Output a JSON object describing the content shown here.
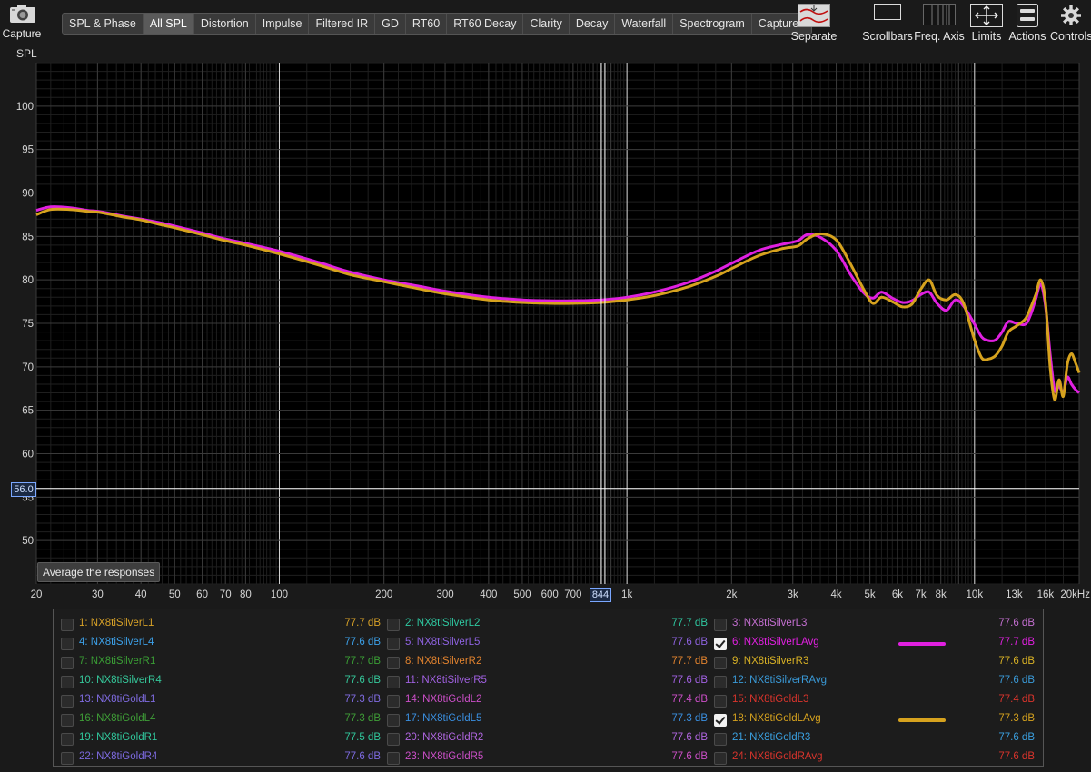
{
  "toolbar": {
    "capture_label": "Capture",
    "tabs": [
      {
        "label": "SPL & Phase",
        "active": false
      },
      {
        "label": "All SPL",
        "active": true
      },
      {
        "label": "Distortion",
        "active": false
      },
      {
        "label": "Impulse",
        "active": false
      },
      {
        "label": "Filtered IR",
        "active": false
      },
      {
        "label": "GD",
        "active": false
      },
      {
        "label": "RT60",
        "active": false
      },
      {
        "label": "RT60 Decay",
        "active": false
      },
      {
        "label": "Clarity",
        "active": false
      },
      {
        "label": "Decay",
        "active": false
      },
      {
        "label": "Waterfall",
        "active": false
      },
      {
        "label": "Spectrogram",
        "active": false
      },
      {
        "label": "Captured",
        "active": false
      }
    ],
    "tools": {
      "separate": "Separate",
      "scrollbars": "Scrollbars",
      "freq_axis": "Freq. Axis",
      "limits": "Limits",
      "actions": "Actions",
      "controls": "Controls"
    }
  },
  "graph": {
    "y_axis_title": "SPL",
    "average_button": "Average the responses",
    "cursor_y_readout": "56.0",
    "cursor_x_readout": "844",
    "colors": {
      "background": "#000000",
      "grid_major": "#3a3a3a",
      "grid_minor": "#1f1f1f",
      "cursor": "#ffffff"
    }
  },
  "chart_data": {
    "type": "line",
    "y_tick_labels": [
      "100",
      "95",
      "90",
      "85",
      "80",
      "75",
      "70",
      "65",
      "60",
      "55",
      "50"
    ],
    "y_ticks": [
      100,
      95,
      90,
      85,
      80,
      75,
      70,
      65,
      60,
      55,
      50
    ],
    "x_tick_labels": [
      {
        "f": 20,
        "t": "20"
      },
      {
        "f": 30,
        "t": "30"
      },
      {
        "f": 40,
        "t": "40"
      },
      {
        "f": 50,
        "t": "50"
      },
      {
        "f": 60,
        "t": "60"
      },
      {
        "f": 70,
        "t": "70"
      },
      {
        "f": 80,
        "t": "80"
      },
      {
        "f": 100,
        "t": "100"
      },
      {
        "f": 200,
        "t": "200"
      },
      {
        "f": 300,
        "t": "300"
      },
      {
        "f": 400,
        "t": "400"
      },
      {
        "f": 500,
        "t": "500"
      },
      {
        "f": 600,
        "t": "600"
      },
      {
        "f": 700,
        "t": "700"
      },
      {
        "f": 800,
        "t": "8"
      },
      {
        "f": 1000,
        "t": "1k"
      },
      {
        "f": 2000,
        "t": "2k"
      },
      {
        "f": 3000,
        "t": "3k"
      },
      {
        "f": 4000,
        "t": "4k"
      },
      {
        "f": 5000,
        "t": "5k"
      },
      {
        "f": 6000,
        "t": "6k"
      },
      {
        "f": 7000,
        "t": "7k"
      },
      {
        "f": 8000,
        "t": "8k"
      },
      {
        "f": 10000,
        "t": "10k"
      },
      {
        "f": 13000,
        "t": "13k"
      },
      {
        "f": 16000,
        "t": "16k"
      },
      {
        "f": 20000,
        "t": "20kHz"
      }
    ],
    "x_scale": "log",
    "xlim": [
      20,
      20000
    ],
    "ylim": [
      45,
      105
    ],
    "cursor": {
      "x": 844,
      "y": 56.0
    },
    "series": [
      {
        "name": "6: NX8tiSilverLAvg",
        "color": "#e020e0",
        "x": [
          20,
          22,
          25,
          28,
          30,
          33,
          36,
          40,
          45,
          50,
          60,
          70,
          80,
          100,
          130,
          160,
          200,
          250,
          300,
          400,
          500,
          600,
          700,
          844,
          1000,
          1200,
          1500,
          1800,
          2000,
          2400,
          2800,
          3100,
          3300,
          3600,
          4000,
          4400,
          4800,
          5100,
          5400,
          5800,
          6200,
          6600,
          7000,
          7400,
          7800,
          8300,
          8800,
          9300,
          10000,
          10500,
          11000,
          11500,
          12000,
          12500,
          13200,
          14000,
          14500,
          15000,
          15500,
          16000,
          16500,
          17000,
          17500,
          18000,
          18500,
          19000,
          19500,
          20000
        ],
        "y": [
          88.0,
          88.4,
          88.3,
          88.0,
          87.9,
          87.6,
          87.3,
          87.0,
          86.6,
          86.2,
          85.4,
          84.7,
          84.2,
          83.3,
          82.0,
          80.9,
          80.0,
          79.3,
          78.7,
          78.0,
          77.7,
          77.6,
          77.6,
          77.7,
          78.0,
          78.6,
          79.7,
          81.0,
          81.9,
          83.4,
          84.1,
          84.5,
          85.2,
          84.9,
          83.4,
          80.6,
          78.5,
          77.9,
          78.6,
          77.9,
          77.4,
          77.6,
          78.3,
          78.6,
          77.3,
          76.5,
          77.7,
          77.0,
          74.9,
          73.4,
          73.0,
          73.1,
          74.0,
          75.2,
          75.0,
          74.9,
          76.0,
          77.8,
          79.5,
          77.0,
          71.5,
          67.3,
          67.8,
          67.0,
          68.8,
          68.0,
          67.4,
          67.0
        ]
      },
      {
        "name": "18: NX8tiGoldLAvg",
        "color": "#d6a21e",
        "x": [
          20,
          22,
          25,
          28,
          30,
          33,
          36,
          40,
          45,
          50,
          60,
          70,
          80,
          100,
          130,
          160,
          200,
          250,
          300,
          400,
          500,
          600,
          700,
          844,
          1000,
          1200,
          1500,
          1800,
          2000,
          2400,
          2800,
          3100,
          3300,
          3600,
          4000,
          4400,
          4800,
          5100,
          5400,
          5800,
          6200,
          6600,
          7000,
          7400,
          7800,
          8300,
          8800,
          9300,
          10000,
          10500,
          11000,
          11500,
          12000,
          12500,
          13200,
          14000,
          14500,
          15000,
          15500,
          16000,
          16500,
          17000,
          17500,
          18000,
          18500,
          19000,
          19500,
          20000
        ],
        "y": [
          87.5,
          88.1,
          88.1,
          87.9,
          87.8,
          87.5,
          87.2,
          86.9,
          86.4,
          86.0,
          85.2,
          84.5,
          84.0,
          83.0,
          81.7,
          80.6,
          79.8,
          79.0,
          78.4,
          77.7,
          77.4,
          77.3,
          77.3,
          77.4,
          77.7,
          78.2,
          79.2,
          80.4,
          81.3,
          82.8,
          83.6,
          83.9,
          84.7,
          85.3,
          84.6,
          81.8,
          78.9,
          77.3,
          78.0,
          77.5,
          76.9,
          77.2,
          78.9,
          80.0,
          78.2,
          77.7,
          78.3,
          77.3,
          73.1,
          71.0,
          70.9,
          71.3,
          72.4,
          74.0,
          74.7,
          75.5,
          76.8,
          78.3,
          80.0,
          77.5,
          70.0,
          66.2,
          68.5,
          66.6,
          70.3,
          71.5,
          70.5,
          69.3
        ]
      }
    ]
  },
  "legend": {
    "rows": [
      [
        {
          "label": "1: NX8tiSilverL1",
          "value": "77.7 dB",
          "color": "#d7a127",
          "checked": false
        },
        {
          "label": "2: NX8tiSilverL2",
          "value": "77.7 dB",
          "color": "#2ec7a0",
          "checked": false
        },
        {
          "label": "3: NX8tiSilverL3",
          "value": "77.6 dB",
          "color": "#c36fd0",
          "checked": false
        }
      ],
      [
        {
          "label": "4: NX8tiSilverL4",
          "value": "77.6 dB",
          "color": "#3ca0e8",
          "checked": false
        },
        {
          "label": "5: NX8tiSilverL5",
          "value": "77.6 dB",
          "color": "#8e62e0",
          "checked": false
        },
        {
          "label": "6: NX8tiSilverLAvg",
          "value": "77.7 dB",
          "color": "#e020e0",
          "checked": true
        }
      ],
      [
        {
          "label": "7: NX8tiSilverR1",
          "value": "77.7 dB",
          "color": "#3a9e35",
          "checked": false
        },
        {
          "label": "8: NX8tiSilverR2",
          "value": "77.7 dB",
          "color": "#e0822e",
          "checked": false
        },
        {
          "label": "9: NX8tiSilverR3",
          "value": "77.6 dB",
          "color": "#d8b125",
          "checked": false
        }
      ],
      [
        {
          "label": "10: NX8tiSilverR4",
          "value": "77.6 dB",
          "color": "#35c79a",
          "checked": false
        },
        {
          "label": "11: NX8tiSilverR5",
          "value": "77.6 dB",
          "color": "#a060e0",
          "checked": false
        },
        {
          "label": "12: NX8tiSilverRAvg",
          "value": "77.6 dB",
          "color": "#3a9ad8",
          "checked": false
        }
      ],
      [
        {
          "label": "13: NX8tiGoldL1",
          "value": "77.3 dB",
          "color": "#7f6be0",
          "checked": false
        },
        {
          "label": "14: NX8tiGoldL2",
          "value": "77.4 dB",
          "color": "#cc4fc8",
          "checked": false
        },
        {
          "label": "15: NX8tiGoldL3",
          "value": "77.4 dB",
          "color": "#d9342c",
          "checked": false
        }
      ],
      [
        {
          "label": "16: NX8tiGoldL4",
          "value": "77.3 dB",
          "color": "#3f9e37",
          "checked": false
        },
        {
          "label": "17: NX8tiGoldL5",
          "value": "77.3 dB",
          "color": "#3a8fe0",
          "checked": false
        },
        {
          "label": "18: NX8tiGoldLAvg",
          "value": "77.3 dB",
          "color": "#d6a21e",
          "checked": true
        }
      ],
      [
        {
          "label": "19: NX8tiGoldR1",
          "value": "77.5 dB",
          "color": "#30c79c",
          "checked": false
        },
        {
          "label": "20: NX8tiGoldR2",
          "value": "77.6 dB",
          "color": "#b066e0",
          "checked": false
        },
        {
          "label": "21: NX8tiGoldR3",
          "value": "77.6 dB",
          "color": "#3aa0e0",
          "checked": false
        }
      ],
      [
        {
          "label": "22: NX8tiGoldR4",
          "value": "77.6 dB",
          "color": "#7d6ae0",
          "checked": false
        },
        {
          "label": "23: NX8tiGoldR5",
          "value": "77.6 dB",
          "color": "#cc4fc8",
          "checked": false
        },
        {
          "label": "24: NX8tiGoldRAvg",
          "value": "77.6 dB",
          "color": "#d9342c",
          "checked": false
        }
      ]
    ]
  }
}
